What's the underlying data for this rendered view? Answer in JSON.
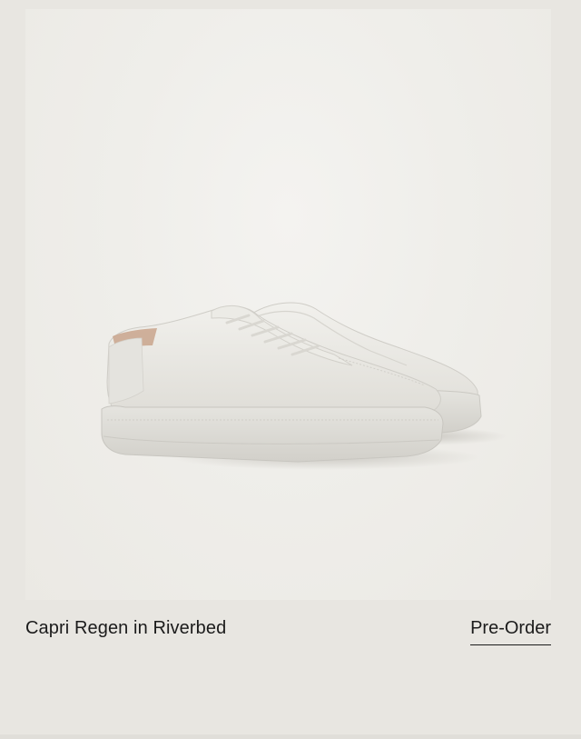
{
  "product": {
    "name": "Capri Regen in Riverbed",
    "cta_label": "Pre-Order",
    "image_alt_icon": "sneaker-product-image"
  },
  "colors": {
    "page_background": "#e8e6e1",
    "photo_background": "#efeeea",
    "text": "#1b1b1b",
    "shoe_upper": "#e9e8e3",
    "shoe_sole": "#dfded9",
    "shoe_lining": "#c9a58c"
  }
}
